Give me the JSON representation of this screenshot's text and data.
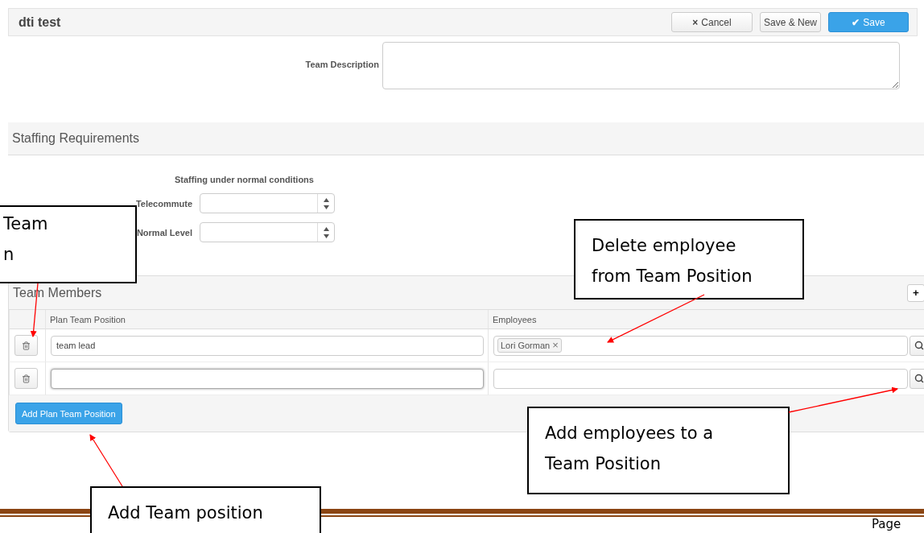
{
  "header": {
    "title": "dti test",
    "buttons": [
      {
        "kind": "cancel",
        "icon": "×",
        "label": "Cancel"
      },
      {
        "kind": "plain",
        "label": "Save & New"
      },
      {
        "kind": "primary",
        "icon": "✔",
        "label": "Save"
      }
    ]
  },
  "description": {
    "label": "Team Description"
  },
  "staffing": {
    "title": "Staffing Requirements",
    "subtitle": "Staffing under normal conditions",
    "fields": [
      {
        "label": "Telecommute"
      },
      {
        "label": "Normal Level"
      }
    ]
  },
  "team_members": {
    "title": "Team Members",
    "add_icon": "+",
    "columns": [
      "Plan Team Position",
      "Employees"
    ],
    "rows": [
      {
        "position": "team lead",
        "focused": false,
        "employees": [
          {
            "name": "Lori Gorman",
            "remove": "×"
          }
        ]
      },
      {
        "position": "",
        "focused": true,
        "employees": []
      }
    ],
    "add_button": "Add Plan Team Position"
  },
  "callouts": [
    {
      "lines": [
        "Team",
        "n"
      ]
    },
    {
      "lines": [
        "Delete employee",
        "from Team Position"
      ]
    },
    {
      "lines": [
        "Add employees to a",
        "Team Position"
      ]
    },
    {
      "lines": [
        "Add Team position"
      ]
    }
  ],
  "footer": {
    "page": "Page"
  }
}
